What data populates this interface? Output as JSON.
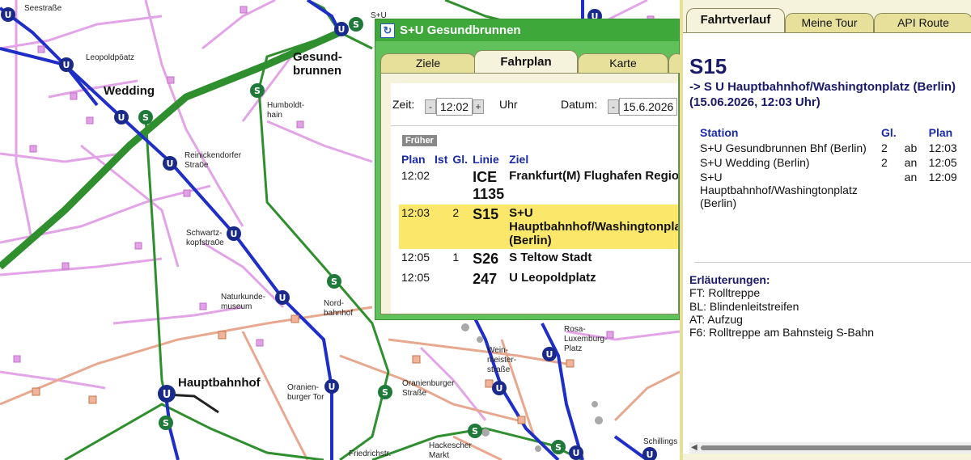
{
  "map": {
    "labels": {
      "seestrasse": "Seestraße",
      "leopoldplatz": "Leopoldpöatz",
      "wedding": "Wedding",
      "gesundbrunnen": "Gesund-\nbrunnen",
      "humboldthain": "Humboldt-\nhain",
      "reinickendorfer": "Reinickendorfer\nStra0e",
      "schwartzkopf": "Schwartz-\nkopfstra0e",
      "naturkunde": "Naturkunde-\nmuseum",
      "nordbahnhof": "Nord-\nbahnhof",
      "rosa": "Rosa-\nLuxemburg-\nPlatz",
      "weinmeister": "Wein-\nmeister-\nstraße",
      "hauptbahnhof": "Hauptbahnhof",
      "oranienburger_tor": "Oranien-\nburger Tor",
      "oranienburger_str": "Oranienburger\nStraße",
      "friedrichstr": "Friedrichstr.",
      "hackescher": "Hackescher\nMarkt",
      "schillings": "Schillings",
      "su_top": "S+U"
    }
  },
  "popup": {
    "title": "S+U Gesundbrunnen",
    "tabs": [
      "Ziele",
      "Fahrplan",
      "Karte"
    ],
    "active_tab": "Fahrplan",
    "zeit_label": "Zeit:",
    "zeit_value": "12:02",
    "uhr_label": "Uhr",
    "datum_label": "Datum:",
    "datum_value": "15.6.2026",
    "minus": "-",
    "plus": "+",
    "frueher": "Früher",
    "columns": [
      "Plan",
      "Ist",
      "Gl.",
      "Linie",
      "Ziel"
    ],
    "rows": [
      {
        "plan": "12:02",
        "ist": "",
        "gl": "",
        "linie": "ICE 1135",
        "ziel": "Frankfurt(M) Flughafen Regionalbf",
        "highlight": false
      },
      {
        "plan": "12:03",
        "ist": "",
        "gl": "2",
        "linie": "S15",
        "ziel": "S+U Hauptbahnhof/Washingtonplatz (Berlin)",
        "highlight": true
      },
      {
        "plan": "12:05",
        "ist": "",
        "gl": "1",
        "linie": "S26",
        "ziel": "S Teltow Stadt",
        "highlight": false
      },
      {
        "plan": "12:05",
        "ist": "",
        "gl": "",
        "linie": "247",
        "ziel": "U Leopoldplatz",
        "highlight": false
      }
    ]
  },
  "panel": {
    "tabs": [
      "Fahrtverlauf",
      "Meine Tour",
      "API Route"
    ],
    "active_tab": "Fahrtverlauf",
    "line": "S15",
    "direction": "-> S U Hauptbahnhof/Washingtonplatz (Berlin)",
    "datetime": "(15.06.2026, 12:03 Uhr)",
    "columns": [
      "Station",
      "Gl.",
      "",
      "Plan"
    ],
    "stops": [
      {
        "station": "S+U Gesundbrunnen Bhf (Berlin)",
        "gl": "2",
        "type": "ab",
        "plan": "12:03"
      },
      {
        "station": "S+U Wedding (Berlin)",
        "gl": "2",
        "type": "an",
        "plan": "12:05"
      },
      {
        "station": "S+U Hauptbahnhof/Washingtonplatz (Berlin)",
        "gl": "",
        "type": "an",
        "plan": "12:09"
      }
    ],
    "legend_title": "Erläuterungen:",
    "legend": [
      "FT: Rolltreppe",
      "BL: Blindenleitstreifen",
      "AT: Aufzug",
      "F6: Rolltreppe am Bahnsteig S-Bahn"
    ]
  },
  "colors": {
    "ubahn": "#1f2ec8",
    "sbahn": "#2f8f2f",
    "bus": "#e2a0e6",
    "tram": "#e8a890",
    "popup_green": "#3fa83a",
    "highlight": "#fbe86a",
    "panel_bg": "#f5f3dc"
  }
}
